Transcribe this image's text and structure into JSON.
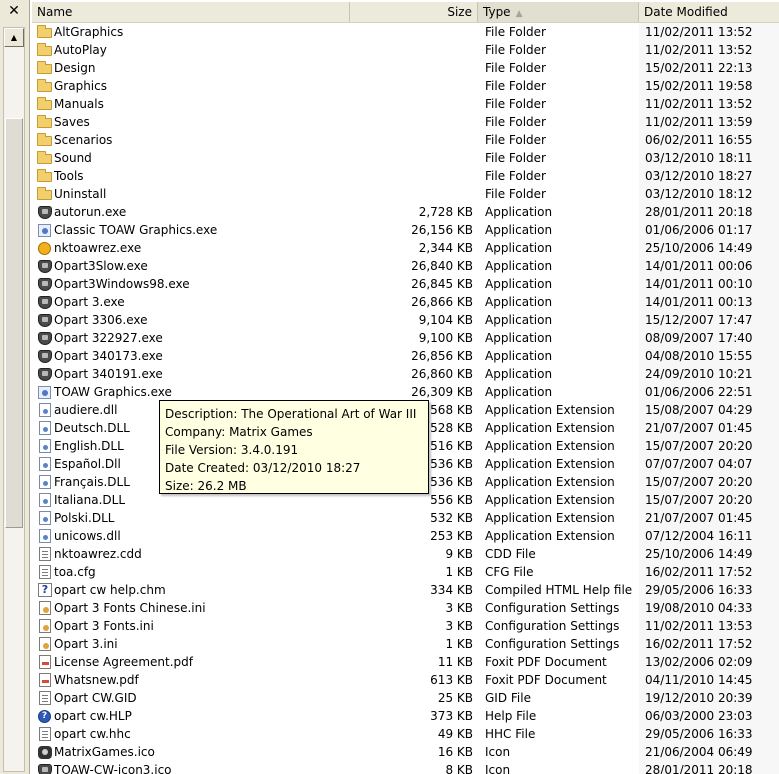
{
  "left_pane": {
    "close_glyph": "✕",
    "scroll_up_glyph": "▲"
  },
  "columns": {
    "name": "Name",
    "size": "Size",
    "type": "Type",
    "date": "Date Modified",
    "sort_glyph": "▲"
  },
  "files": [
    {
      "name": "AltGraphics",
      "size": "",
      "type": "File Folder",
      "date": "11/02/2011 13:52",
      "icon": "folder-icon"
    },
    {
      "name": "AutoPlay",
      "size": "",
      "type": "File Folder",
      "date": "11/02/2011 13:52",
      "icon": "folder-icon"
    },
    {
      "name": "Design",
      "size": "",
      "type": "File Folder",
      "date": "15/02/2011 22:13",
      "icon": "folder-icon"
    },
    {
      "name": "Graphics",
      "size": "",
      "type": "File Folder",
      "date": "15/02/2011 19:58",
      "icon": "folder-icon"
    },
    {
      "name": "Manuals",
      "size": "",
      "type": "File Folder",
      "date": "11/02/2011 13:52",
      "icon": "folder-icon"
    },
    {
      "name": "Saves",
      "size": "",
      "type": "File Folder",
      "date": "11/02/2011 13:59",
      "icon": "folder-icon"
    },
    {
      "name": "Scenarios",
      "size": "",
      "type": "File Folder",
      "date": "06/02/2011 16:55",
      "icon": "folder-icon"
    },
    {
      "name": "Sound",
      "size": "",
      "type": "File Folder",
      "date": "03/12/2010 18:11",
      "icon": "folder-icon"
    },
    {
      "name": "Tools",
      "size": "",
      "type": "File Folder",
      "date": "03/12/2010 18:27",
      "icon": "folder-icon"
    },
    {
      "name": "Uninstall",
      "size": "",
      "type": "File Folder",
      "date": "03/12/2010 18:12",
      "icon": "folder-icon"
    },
    {
      "name": "autorun.exe",
      "size": "2,728 KB",
      "type": "Application",
      "date": "28/01/2011 20:18",
      "icon": "app-icon"
    },
    {
      "name": "Classic TOAW Graphics.exe",
      "size": "26,156 KB",
      "type": "Application",
      "date": "01/06/2006 01:17",
      "icon": "exe-blue-icon"
    },
    {
      "name": "nktoawrez.exe",
      "size": "2,344 KB",
      "type": "Application",
      "date": "25/10/2006 14:49",
      "icon": "exe-gold-icon"
    },
    {
      "name": "Opart3Slow.exe",
      "size": "26,840 KB",
      "type": "Application",
      "date": "14/01/2011 00:06",
      "icon": "app-icon"
    },
    {
      "name": "Opart3Windows98.exe",
      "size": "26,845 KB",
      "type": "Application",
      "date": "14/01/2011 00:10",
      "icon": "app-icon"
    },
    {
      "name": "Opart 3.exe",
      "size": "26,866 KB",
      "type": "Application",
      "date": "14/01/2011 00:13",
      "icon": "app-icon"
    },
    {
      "name": "Opart 3306.exe",
      "size": "9,104 KB",
      "type": "Application",
      "date": "15/12/2007 17:47",
      "icon": "app-icon"
    },
    {
      "name": "Opart 322927.exe",
      "size": "9,100 KB",
      "type": "Application",
      "date": "08/09/2007 17:40",
      "icon": "app-icon"
    },
    {
      "name": "Opart 340173.exe",
      "size": "26,856 KB",
      "type": "Application",
      "date": "04/08/2010 15:55",
      "icon": "app-icon"
    },
    {
      "name": "Opart 340191.exe",
      "size": "26,860 KB",
      "type": "Application",
      "date": "24/09/2010 10:21",
      "icon": "app-icon"
    },
    {
      "name": "TOAW Graphics.exe",
      "size": "26,309 KB",
      "type": "Application",
      "date": "01/06/2006 22:51",
      "icon": "exe-blue-icon"
    },
    {
      "name": "audiere.dll",
      "size": "568 KB",
      "type": "Application Extension",
      "date": "15/08/2007 04:29",
      "icon": "dll-icon"
    },
    {
      "name": "Deutsch.DLL",
      "size": "528 KB",
      "type": "Application Extension",
      "date": "21/07/2007 01:45",
      "icon": "dll-icon"
    },
    {
      "name": "English.DLL",
      "size": "516 KB",
      "type": "Application Extension",
      "date": "15/07/2007 20:20",
      "icon": "dll-icon"
    },
    {
      "name": "Español.Dll",
      "size": "536 KB",
      "type": "Application Extension",
      "date": "07/07/2007 04:07",
      "icon": "dll-icon"
    },
    {
      "name": "Français.DLL",
      "size": "536 KB",
      "type": "Application Extension",
      "date": "15/07/2007 20:20",
      "icon": "dll-icon"
    },
    {
      "name": "Italiana.DLL",
      "size": "556 KB",
      "type": "Application Extension",
      "date": "15/07/2007 20:20",
      "icon": "dll-icon"
    },
    {
      "name": "Polski.DLL",
      "size": "532 KB",
      "type": "Application Extension",
      "date": "21/07/2007 01:45",
      "icon": "dll-icon"
    },
    {
      "name": "unicows.dll",
      "size": "253 KB",
      "type": "Application Extension",
      "date": "07/12/2004 16:11",
      "icon": "dll-icon"
    },
    {
      "name": "nktoawrez.cdd",
      "size": "9 KB",
      "type": "CDD File",
      "date": "25/10/2006 14:49",
      "icon": "file-icon"
    },
    {
      "name": "toa.cfg",
      "size": "1 KB",
      "type": "CFG File",
      "date": "16/02/2011 17:52",
      "icon": "file-icon"
    },
    {
      "name": "opart cw help.chm",
      "size": "334 KB",
      "type": "Compiled HTML Help file",
      "date": "29/05/2006 16:33",
      "icon": "chm-icon"
    },
    {
      "name": "Opart 3 Fonts Chinese.ini",
      "size": "3 KB",
      "type": "Configuration Settings",
      "date": "19/08/2010 04:33",
      "icon": "ini-icon"
    },
    {
      "name": "Opart 3 Fonts.ini",
      "size": "3 KB",
      "type": "Configuration Settings",
      "date": "11/02/2011 13:53",
      "icon": "ini-icon"
    },
    {
      "name": "Opart 3.ini",
      "size": "1 KB",
      "type": "Configuration Settings",
      "date": "16/02/2011 17:52",
      "icon": "ini-icon"
    },
    {
      "name": "License Agreement.pdf",
      "size": "11 KB",
      "type": "Foxit PDF Document",
      "date": "13/02/2006 02:09",
      "icon": "pdf-icon"
    },
    {
      "name": "Whatsnew.pdf",
      "size": "613 KB",
      "type": "Foxit PDF Document",
      "date": "04/11/2010 14:45",
      "icon": "pdf-icon"
    },
    {
      "name": "Opart CW.GID",
      "size": "25 KB",
      "type": "GID File",
      "date": "19/12/2010 20:39",
      "icon": "file-icon"
    },
    {
      "name": "opart cw.HLP",
      "size": "373 KB",
      "type": "Help File",
      "date": "06/03/2000 23:03",
      "icon": "hlp-icon"
    },
    {
      "name": "opart cw.hhc",
      "size": "49 KB",
      "type": "HHC File",
      "date": "29/05/2006 16:33",
      "icon": "file-icon"
    },
    {
      "name": "MatrixGames.ico",
      "size": "16 KB",
      "type": "Icon",
      "date": "21/06/2004 06:49",
      "icon": "ico-icon"
    },
    {
      "name": "TOAW-CW-icon3.ico",
      "size": "8 KB",
      "type": "Icon",
      "date": "28/01/2011 20:18",
      "icon": "app-icon"
    }
  ],
  "tooltip": {
    "description": "Description: The Operational Art of War III",
    "company": "Company: Matrix Games",
    "version": "File Version: 3.4.0.191",
    "created": "Date Created: 03/12/2010 18:27",
    "size": "Size: 26.2 MB"
  }
}
